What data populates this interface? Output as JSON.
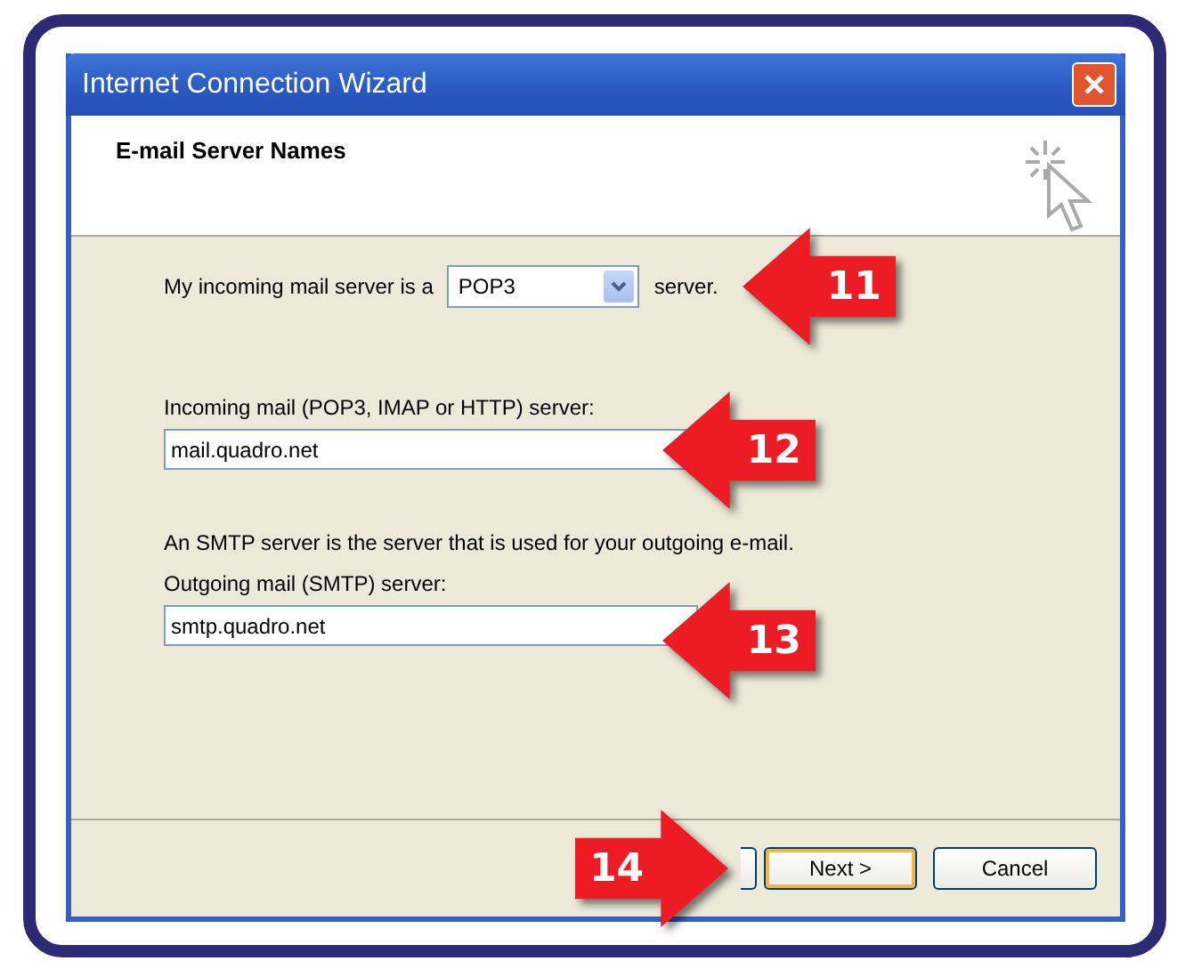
{
  "window": {
    "title": "Internet Connection Wizard"
  },
  "header": {
    "title": "E-mail Server Names"
  },
  "server_type": {
    "label": "My incoming mail server is a",
    "value": "POP3",
    "suffix": "server.",
    "callout": "11"
  },
  "incoming": {
    "label": "Incoming mail (POP3, IMAP or HTTP) server:",
    "value": "mail.quadro.net",
    "callout": "12"
  },
  "smtp_note": "An SMTP server is the server that is used for your outgoing e-mail.",
  "outgoing": {
    "label": "Outgoing mail (SMTP) server:",
    "value": "smtp.quadro.net",
    "callout": "13"
  },
  "footer": {
    "callout": "14",
    "buttons": [
      {
        "label": "Next >",
        "default": true
      },
      {
        "label": "Cancel",
        "default": false
      }
    ]
  }
}
